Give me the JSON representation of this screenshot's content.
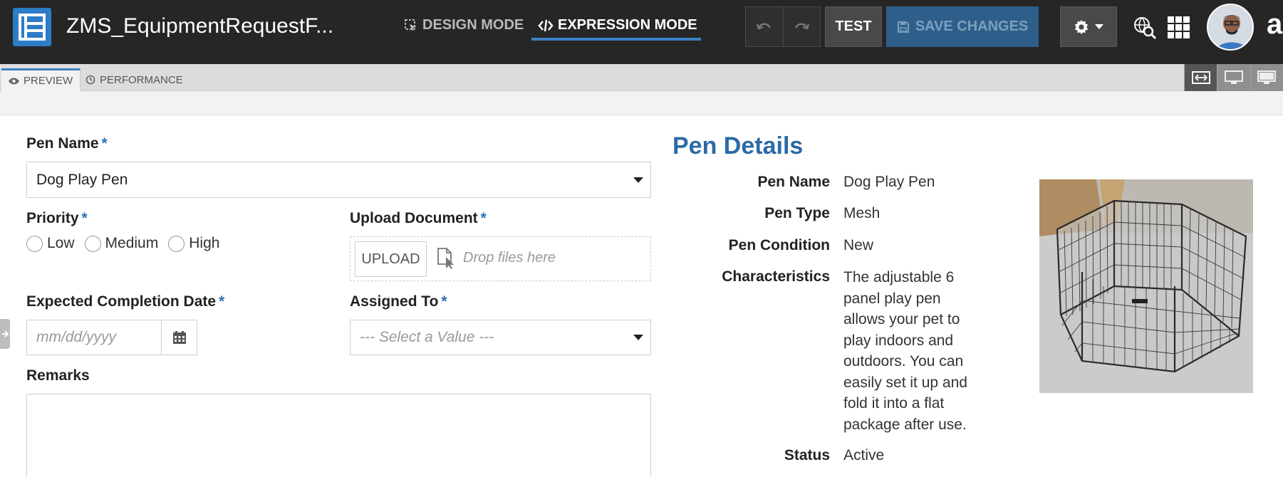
{
  "app": {
    "title": "ZMS_EquipmentRequestF...",
    "modes": {
      "design": "DESIGN MODE",
      "expression": "EXPRESSION MODE"
    },
    "buttons": {
      "test": "TEST",
      "save": "SAVE CHANGES"
    },
    "brand_letter": "a",
    "accent_color": "#2c7cc7"
  },
  "tabs": {
    "preview": "PREVIEW",
    "performance": "PERFORMANCE"
  },
  "form": {
    "pen_name": {
      "label": "Pen Name",
      "required": "*",
      "value": "Dog Play Pen"
    },
    "priority": {
      "label": "Priority",
      "required": "*",
      "options": [
        "Low",
        "Medium",
        "High"
      ]
    },
    "upload": {
      "label": "Upload Document",
      "required": "*",
      "button": "UPLOAD",
      "drop_text": "Drop files here"
    },
    "completion_date": {
      "label": "Expected Completion Date",
      "required": "*",
      "placeholder": "mm/dd/yyyy"
    },
    "assigned_to": {
      "label": "Assigned To",
      "required": "*",
      "placeholder": "--- Select a Value ---"
    },
    "remarks": {
      "label": "Remarks"
    }
  },
  "details": {
    "title": "Pen Details",
    "fields": [
      {
        "label": "Pen Name",
        "value": "Dog Play Pen"
      },
      {
        "label": "Pen Type",
        "value": "Mesh"
      },
      {
        "label": "Pen Condition",
        "value": "New"
      },
      {
        "label": "Characteristics",
        "value": "The adjustable 6 panel play pen allows your pet to play indoors and outdoors. You can easily set it up and fold it into a flat package after use."
      },
      {
        "label": "Status",
        "value": "Active"
      }
    ]
  }
}
